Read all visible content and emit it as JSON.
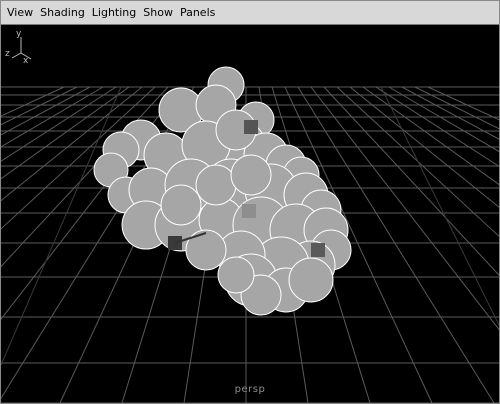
{
  "menubar": {
    "items": [
      {
        "label": "View"
      },
      {
        "label": "Shading"
      },
      {
        "label": "Lighting"
      },
      {
        "label": "Show"
      },
      {
        "label": "Panels"
      }
    ]
  },
  "viewport": {
    "camera_label": "persp",
    "axis": {
      "x_label": "x",
      "y_label": "y",
      "z_label": "z"
    },
    "colors": {
      "background": "#000000",
      "grid": "#5a5a5a",
      "spheres": "#a6a6a6",
      "sphere_outline": "#ffffff"
    }
  }
}
